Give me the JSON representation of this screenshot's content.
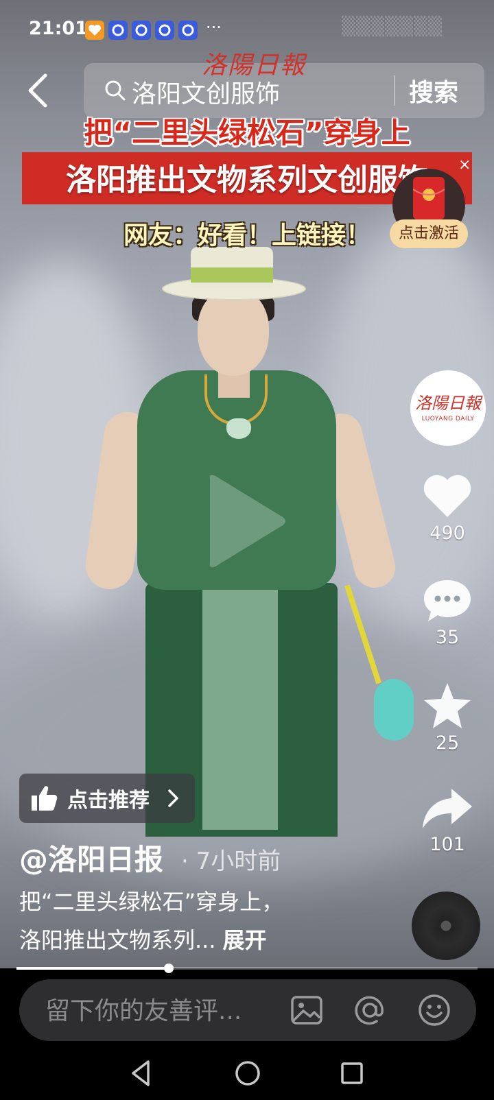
{
  "status_bar": {
    "time": "21:01",
    "more": "···"
  },
  "search": {
    "query": "洛阳文创服饰",
    "button": "搜索"
  },
  "watermark": "洛陽日報",
  "headline": {
    "line1": "把“二里头绿松石”穿身上",
    "line2": "洛阳推出文物系列文创服饰",
    "line3": "网友：好看！上链接！"
  },
  "red_packet": {
    "label": "点击激活",
    "close": "×"
  },
  "account": {
    "logo": "洛陽日報",
    "subtitle": "LUOYANG DAILY"
  },
  "actions": {
    "likes": "490",
    "comments": "35",
    "favorites": "25",
    "shares": "101"
  },
  "recommend": {
    "label": "点击推荐"
  },
  "caption": {
    "author": "@洛阳日报",
    "time": "· 7小时前",
    "line1": "把“二里头绿松石”穿身上，",
    "line2": "洛阳推出文物系列...",
    "expand": "展开"
  },
  "progress": {
    "fraction": 0.33
  },
  "comment": {
    "placeholder": "留下你的友善评..."
  }
}
